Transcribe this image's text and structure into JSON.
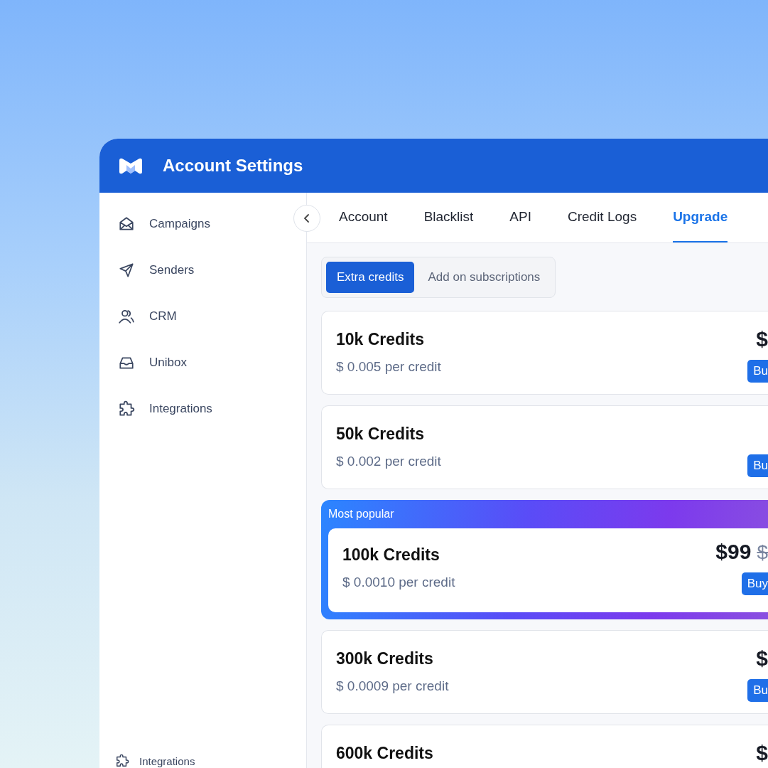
{
  "window": {
    "title": "Account Settings"
  },
  "sidebar": {
    "items": [
      {
        "label": "Campaigns",
        "kind": "envelope"
      },
      {
        "label": "Senders",
        "kind": "send"
      },
      {
        "label": "CRM",
        "kind": "users"
      },
      {
        "label": "Unibox",
        "kind": "inbox"
      },
      {
        "label": "Integrations",
        "kind": "puzzle"
      }
    ],
    "footer": {
      "label": "Integrations",
      "kind": "puzzle"
    }
  },
  "tabs": [
    {
      "label": "Account",
      "selected": false
    },
    {
      "label": "Blacklist",
      "selected": false
    },
    {
      "label": "API",
      "selected": false
    },
    {
      "label": "Credit Logs",
      "selected": false
    },
    {
      "label": "Upgrade",
      "selected": true
    }
  ],
  "plan_toggle": [
    {
      "label": "Extra credits",
      "selected": true
    },
    {
      "label": "Add on subscriptions",
      "selected": false
    }
  ],
  "plans": [
    {
      "title": "10k Credits",
      "rate": "$ 0.005 per credit",
      "price": "$",
      "button": "Bu"
    },
    {
      "title": "50k Credits",
      "rate": "$ 0.002 per credit",
      "button": "Bu"
    },
    {
      "badge": "Most popular",
      "title": "100k Credits",
      "rate": "$ 0.0010 per credit",
      "price": "$99",
      "old_price": "$",
      "button": "Buy"
    },
    {
      "title": "300k Credits",
      "rate": "$ 0.0009 per credit",
      "price": "$",
      "button": "Bu"
    },
    {
      "title": "600k Credits",
      "price": "$"
    }
  ]
}
